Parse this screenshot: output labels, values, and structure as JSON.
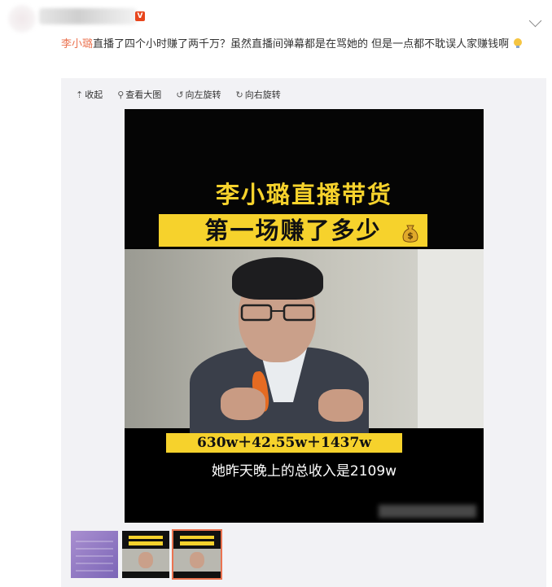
{
  "post": {
    "mention": "李小璐",
    "text": "直播了四个小时赚了两千万？虽然直播间弹幕都是在骂她的 但是一点都不耽误人家赚钱啊",
    "emoji": "bulb-face-icon"
  },
  "toolbar": {
    "items": [
      {
        "label": "收起",
        "icon": "collapse-up-icon"
      },
      {
        "label": "查看大图",
        "icon": "magnifier-icon"
      },
      {
        "label": "向左旋转",
        "icon": "rotate-left-icon"
      },
      {
        "label": "向右旋转",
        "icon": "rotate-right-icon"
      }
    ]
  },
  "image": {
    "title_line1": "李小璐直播带货",
    "title_line2": "第一场赚了多少",
    "sum": "630w＋42.55w＋1437w",
    "caption": "她昨天晚上的总收入是2109w"
  },
  "colors": {
    "mention": "#eb7350",
    "title_yellow": "#f6d22c",
    "panel_bg": "#f2f2f5"
  },
  "thumbnails": [
    {
      "selected": false
    },
    {
      "selected": false
    },
    {
      "selected": true
    }
  ]
}
